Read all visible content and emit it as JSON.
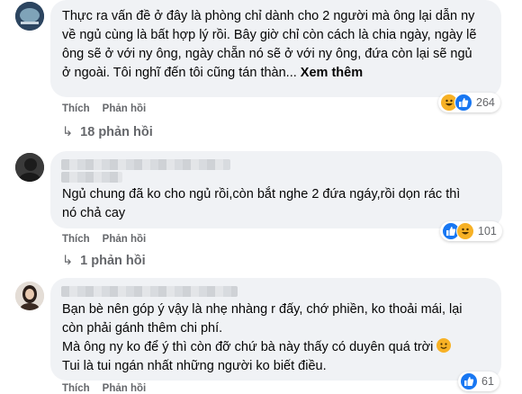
{
  "comments": [
    {
      "lines": [
        "Thực ra vấn đề ở đây là phòng chỉ dành cho 2 người mà ông lại dẫn ny",
        "về ngủ cùng là bất hợp lý rồi. Bây giờ chỉ còn cách là chia ngày, ngày lẽ",
        "ông sẽ ở với ny ông, ngày chẵn nó sẽ ở với ny ông, đứa còn lại sẽ ngủ",
        "ở ngoài. Tôi nghĩ đến tôi cũng tán thàn..."
      ],
      "see_more": "Xem thêm",
      "like_label": "Thích",
      "reply_label": "Phản hồi",
      "reactions": [
        "haha",
        "like"
      ],
      "reaction_count": "264",
      "replies_label": "18 phản hồi"
    },
    {
      "lines": [
        "Ngủ chung đã ko cho ngủ rồi,còn bắt nghe 2 đứa ngáy,rồi dọn rác thì",
        "nó chả cay"
      ],
      "like_label": "Thích",
      "reply_label": "Phản hồi",
      "reactions": [
        "like",
        "haha"
      ],
      "reaction_count": "101",
      "replies_label": "1 phản hồi"
    },
    {
      "lines": [
        "Bạn bè nên góp ý vậy là nhẹ nhàng r đấy, chớ phiền, ko thoải mái, lại",
        "còn phải gánh thêm chi phí.",
        "Mà ông ny ko để ý thì còn đỡ chứ bà này thấy có duyên quá trời",
        "Tui là tui ngán nhất những người ko biết điều."
      ],
      "emoji": "slightly-smiling-face-icon",
      "like_label": "Thích",
      "reply_label": "Phản hồi",
      "reactions": [
        "like"
      ],
      "reaction_count": "61"
    }
  ],
  "colors": {
    "bubble": "#f0f2f5",
    "text": "#050505",
    "secondary": "#65676b",
    "like_blue": "#1877f2",
    "haha_yellow": "#f7b125"
  }
}
